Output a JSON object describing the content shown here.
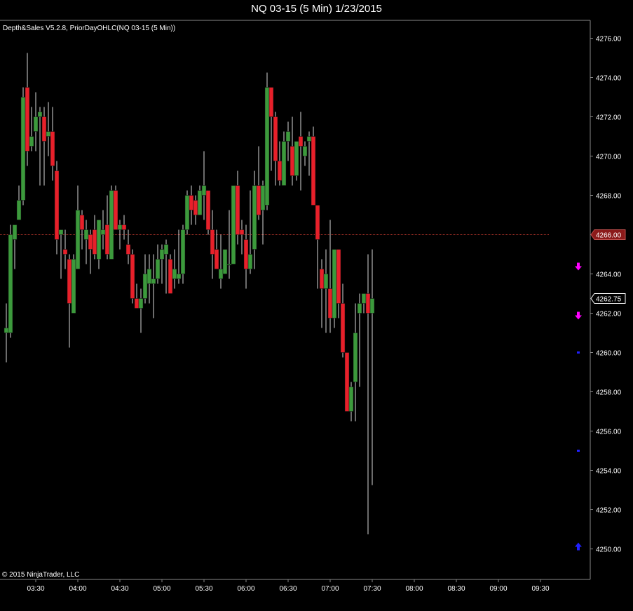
{
  "window": {
    "title": "NQ 03-15 (5 Min)  1/23/2015"
  },
  "chart_data": {
    "type": "candlestick",
    "indicator_label": "Depth&Sales V5.2.8, PriorDayOHLC(NQ 03-15 (5 Min))",
    "copyright": "© 2015 NinjaTrader, LLC",
    "ylim": [
      4249,
      4277
    ],
    "y_ticks": [
      "4250.00",
      "4252.00",
      "4254.00",
      "4256.00",
      "4258.00",
      "4260.00",
      "4262.00",
      "4264.00",
      "4266.00",
      "4268.00",
      "4270.00",
      "4272.00",
      "4274.00",
      "4276.00"
    ],
    "x_ticks": [
      {
        "label": "03:30",
        "index": 7
      },
      {
        "label": "04:00",
        "index": 17
      },
      {
        "label": "04:30",
        "index": 27
      },
      {
        "label": "05:00",
        "index": 37
      },
      {
        "label": "05:30",
        "index": 47
      },
      {
        "label": "06:00",
        "index": 57
      },
      {
        "label": "06:30",
        "index": 67
      },
      {
        "label": "07:00",
        "index": 77
      },
      {
        "label": "07:30",
        "index": 87
      },
      {
        "label": "08:00",
        "index": 97
      },
      {
        "label": "08:30",
        "index": 107
      },
      {
        "label": "09:00",
        "index": 117
      },
      {
        "label": "09:30",
        "index": 127
      }
    ],
    "prior_day_level": 4266.0,
    "prior_day_label": "4266.00",
    "last_price": 4262.75,
    "last_price_label": "4262.75",
    "colors": {
      "up": "#3c9a3c",
      "down": "#e8202a",
      "wick": "#d8d8d8",
      "prior_day_line": "#b0342a",
      "prior_day_badge": "#8b1a1a",
      "sell_arrow": "#ff00ff",
      "buy_arrow": "#2020ff"
    },
    "candles": [
      {
        "o": 4261.0,
        "h": 4262.5,
        "l": 4259.5,
        "c": 4261.25
      },
      {
        "o": 4261.0,
        "h": 4266.5,
        "l": 4260.75,
        "c": 4266.0
      },
      {
        "o": 4265.75,
        "h": 4266.5,
        "l": 4264.25,
        "c": 4266.5
      },
      {
        "o": 4266.75,
        "h": 4268.5,
        "l": 4266.75,
        "c": 4267.75
      },
      {
        "o": 4267.75,
        "h": 4273.5,
        "l": 4267.5,
        "c": 4273.0
      },
      {
        "o": 4273.5,
        "h": 4275.25,
        "l": 4269.5,
        "c": 4270.25
      },
      {
        "o": 4270.5,
        "h": 4272.5,
        "l": 4270.25,
        "c": 4271.0
      },
      {
        "o": 4271.25,
        "h": 4273.25,
        "l": 4270.25,
        "c": 4272.0
      },
      {
        "o": 4272.0,
        "h": 4272.5,
        "l": 4268.5,
        "c": 4272.25
      },
      {
        "o": 4272.0,
        "h": 4272.5,
        "l": 4268.5,
        "c": 4270.75
      },
      {
        "o": 4271.0,
        "h": 4272.75,
        "l": 4270.0,
        "c": 4271.25
      },
      {
        "o": 4271.25,
        "h": 4272.5,
        "l": 4268.75,
        "c": 4269.5
      },
      {
        "o": 4269.25,
        "h": 4269.75,
        "l": 4265.0,
        "c": 4265.75
      },
      {
        "o": 4266.0,
        "h": 4266.25,
        "l": 4263.75,
        "c": 4266.25
      },
      {
        "o": 4265.25,
        "h": 4266.25,
        "l": 4264.25,
        "c": 4265.0
      },
      {
        "o": 4264.75,
        "h": 4265.0,
        "l": 4260.25,
        "c": 4262.5
      },
      {
        "o": 4262.0,
        "h": 4265.0,
        "l": 4262.0,
        "c": 4264.75
      },
      {
        "o": 4264.25,
        "h": 4268.5,
        "l": 4264.25,
        "c": 4267.25
      },
      {
        "o": 4267.0,
        "h": 4267.25,
        "l": 4265.25,
        "c": 4266.25
      },
      {
        "o": 4265.75,
        "h": 4266.75,
        "l": 4264.5,
        "c": 4266.25
      },
      {
        "o": 4266.0,
        "h": 4266.25,
        "l": 4264.0,
        "c": 4265.25
      },
      {
        "o": 4266.25,
        "h": 4267.0,
        "l": 4264.75,
        "c": 4265.0
      },
      {
        "o": 4264.75,
        "h": 4266.75,
        "l": 4264.25,
        "c": 4266.75
      },
      {
        "o": 4266.0,
        "h": 4267.25,
        "l": 4265.25,
        "c": 4266.25
      },
      {
        "o": 4266.5,
        "h": 4268.0,
        "l": 4264.75,
        "c": 4265.0
      },
      {
        "o": 4264.75,
        "h": 4268.5,
        "l": 4264.75,
        "c": 4268.25
      },
      {
        "o": 4268.25,
        "h": 4268.5,
        "l": 4266.5,
        "c": 4266.25
      },
      {
        "o": 4266.25,
        "h": 4266.75,
        "l": 4265.25,
        "c": 4266.5
      },
      {
        "o": 4266.5,
        "h": 4267.0,
        "l": 4265.75,
        "c": 4266.25
      },
      {
        "o": 4265.5,
        "h": 4266.25,
        "l": 4264.5,
        "c": 4265.0
      },
      {
        "o": 4265.0,
        "h": 4265.25,
        "l": 4262.5,
        "c": 4262.75
      },
      {
        "o": 4262.75,
        "h": 4263.5,
        "l": 4262.25,
        "c": 4262.25
      },
      {
        "o": 4262.25,
        "h": 4263.25,
        "l": 4261.0,
        "c": 4262.75
      },
      {
        "o": 4262.75,
        "h": 4265.0,
        "l": 4262.5,
        "c": 4264.0
      },
      {
        "o": 4263.5,
        "h": 4265.0,
        "l": 4262.5,
        "c": 4264.25
      },
      {
        "o": 4263.5,
        "h": 4265.0,
        "l": 4261.75,
        "c": 4263.75
      },
      {
        "o": 4263.75,
        "h": 4265.5,
        "l": 4263.5,
        "c": 4264.75
      },
      {
        "o": 4264.75,
        "h": 4265.5,
        "l": 4263.5,
        "c": 4265.25
      },
      {
        "o": 4265.0,
        "h": 4265.75,
        "l": 4263.0,
        "c": 4265.5
      },
      {
        "o": 4264.75,
        "h": 4265.0,
        "l": 4263.0,
        "c": 4263.0
      },
      {
        "o": 4263.75,
        "h": 4265.25,
        "l": 4263.25,
        "c": 4264.25
      },
      {
        "o": 4263.75,
        "h": 4266.25,
        "l": 4263.5,
        "c": 4264.0
      },
      {
        "o": 4264.0,
        "h": 4266.5,
        "l": 4263.5,
        "c": 4266.25
      },
      {
        "o": 4266.25,
        "h": 4268.25,
        "l": 4266.0,
        "c": 4268.0
      },
      {
        "o": 4268.0,
        "h": 4268.5,
        "l": 4266.5,
        "c": 4267.25
      },
      {
        "o": 4267.75,
        "h": 4268.0,
        "l": 4266.5,
        "c": 4267.0
      },
      {
        "o": 4267.0,
        "h": 4268.5,
        "l": 4267.0,
        "c": 4268.25
      },
      {
        "o": 4268.0,
        "h": 4270.25,
        "l": 4266.75,
        "c": 4268.5
      },
      {
        "o": 4268.25,
        "h": 4268.25,
        "l": 4266.0,
        "c": 4266.25
      },
      {
        "o": 4266.25,
        "h": 4267.25,
        "l": 4263.75,
        "c": 4265.0
      },
      {
        "o": 4265.25,
        "h": 4266.25,
        "l": 4264.25,
        "c": 4264.25
      },
      {
        "o": 4263.75,
        "h": 4266.0,
        "l": 4263.25,
        "c": 4264.25
      },
      {
        "o": 4264.0,
        "h": 4265.0,
        "l": 4264.0,
        "c": 4265.25
      },
      {
        "o": 4264.5,
        "h": 4267.25,
        "l": 4263.75,
        "c": 4264.5
      },
      {
        "o": 4264.5,
        "h": 4268.5,
        "l": 4264.5,
        "c": 4268.5
      },
      {
        "o": 4268.5,
        "h": 4269.25,
        "l": 4265.5,
        "c": 4266.0
      },
      {
        "o": 4266.25,
        "h": 4266.75,
        "l": 4265.0,
        "c": 4266.0
      },
      {
        "o": 4265.75,
        "h": 4266.5,
        "l": 4263.25,
        "c": 4264.25
      },
      {
        "o": 4264.25,
        "h": 4268.25,
        "l": 4264.0,
        "c": 4265.0
      },
      {
        "o": 4265.25,
        "h": 4269.25,
        "l": 4264.25,
        "c": 4268.5
      },
      {
        "o": 4268.5,
        "h": 4270.5,
        "l": 4266.75,
        "c": 4267.0
      },
      {
        "o": 4267.25,
        "h": 4268.75,
        "l": 4265.5,
        "c": 4268.5
      },
      {
        "o": 4267.5,
        "h": 4274.25,
        "l": 4267.25,
        "c": 4273.5
      },
      {
        "o": 4273.5,
        "h": 4273.5,
        "l": 4269.25,
        "c": 4272.0
      },
      {
        "o": 4272.0,
        "h": 4272.25,
        "l": 4268.5,
        "c": 4269.75
      },
      {
        "o": 4269.75,
        "h": 4270.75,
        "l": 4268.5,
        "c": 4268.75
      },
      {
        "o": 4268.5,
        "h": 4271.25,
        "l": 4268.5,
        "c": 4270.75
      },
      {
        "o": 4270.75,
        "h": 4271.75,
        "l": 4269.75,
        "c": 4271.25
      },
      {
        "o": 4270.5,
        "h": 4272.0,
        "l": 4268.5,
        "c": 4269.0
      },
      {
        "o": 4269.0,
        "h": 4270.75,
        "l": 4268.75,
        "c": 4270.75
      },
      {
        "o": 4271.0,
        "h": 4272.25,
        "l": 4268.25,
        "c": 4270.5
      },
      {
        "o": 4270.0,
        "h": 4270.75,
        "l": 4269.5,
        "c": 4270.5
      },
      {
        "o": 4270.75,
        "h": 4271.25,
        "l": 4269.0,
        "c": 4271.0
      },
      {
        "o": 4271.0,
        "h": 4271.5,
        "l": 4268.0,
        "c": 4267.5
      },
      {
        "o": 4267.5,
        "h": 4267.5,
        "l": 4263.25,
        "c": 4265.75
      },
      {
        "o": 4264.25,
        "h": 4264.75,
        "l": 4261.25,
        "c": 4263.25
      },
      {
        "o": 4263.25,
        "h": 4265.25,
        "l": 4261.0,
        "c": 4264.0
      },
      {
        "o": 4263.25,
        "h": 4266.75,
        "l": 4261.0,
        "c": 4261.75
      },
      {
        "o": 4261.75,
        "h": 4265.25,
        "l": 4261.25,
        "c": 4265.25
      },
      {
        "o": 4265.25,
        "h": 4265.25,
        "l": 4261.75,
        "c": 4262.5
      },
      {
        "o": 4262.5,
        "h": 4263.5,
        "l": 4259.75,
        "c": 4260.0
      },
      {
        "o": 4260.0,
        "h": 4260.0,
        "l": 4257.0,
        "c": 4257.0
      },
      {
        "o": 4257.0,
        "h": 4258.5,
        "l": 4256.5,
        "c": 4258.25
      },
      {
        "o": 4258.5,
        "h": 4262.5,
        "l": 4256.5,
        "c": 4261.0
      },
      {
        "o": 4262.0,
        "h": 4263.0,
        "l": 4258.25,
        "c": 4262.5
      },
      {
        "o": 4262.5,
        "h": 4263.0,
        "l": 4262.0,
        "c": 4263.0
      },
      {
        "o": 4263.0,
        "h": 4265.0,
        "l": 4250.75,
        "c": 4262.0
      },
      {
        "o": 4262.0,
        "h": 4265.25,
        "l": 4253.25,
        "c": 4262.75
      }
    ],
    "markers": [
      {
        "type": "sell-arrow",
        "index": 136,
        "price": 4264.25
      },
      {
        "type": "sell-arrow",
        "index": 136,
        "price": 4261.75
      },
      {
        "type": "buy-arrow",
        "index": 136,
        "price": 4250.25
      },
      {
        "type": "dash",
        "index": 136,
        "price": 4260.0
      },
      {
        "type": "dash",
        "index": 136,
        "price": 4255.0
      }
    ]
  }
}
